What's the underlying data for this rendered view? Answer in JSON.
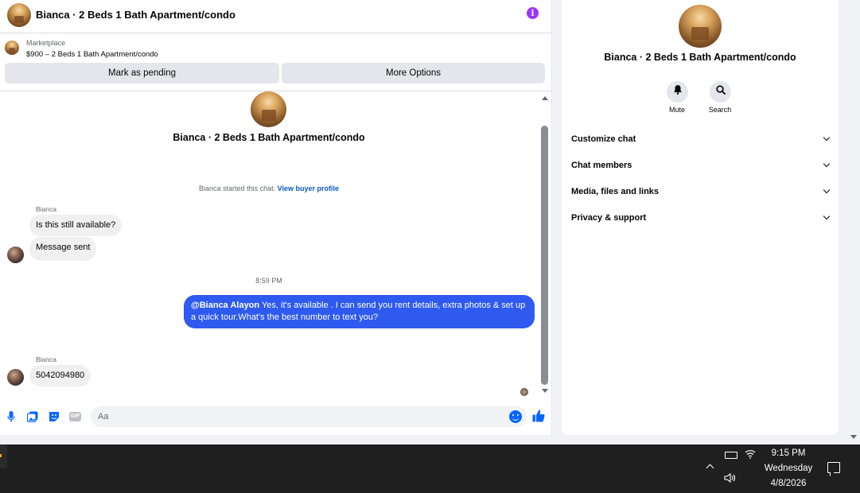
{
  "chat": {
    "header_title": "Bianca · 2 Beds 1 Bath Apartment/condo",
    "marketplace_label": "Marketplace",
    "listing_title": "$900 – 2 Beds 1 Bath Apartment/condo",
    "mark_pending_label": "Mark as pending",
    "more_options_label": "More Options",
    "center_title": "Bianca · 2 Beds 1 Bath Apartment/condo",
    "started_text": "Bianca started this chat.",
    "view_profile_link": "View buyer profile",
    "messages": [
      {
        "sender": "Bianca",
        "text": "Is this still available?"
      },
      {
        "text": "Message sent"
      },
      {
        "timestamp": "8:59 PM"
      },
      {
        "mention": "@Bianca Alayon",
        "text": " Yes, it's available .  I can send you rent details, extra photos & set up a quick tour.What's the best number to text you?"
      },
      {
        "sender": "Bianca",
        "text": "5042094980"
      }
    ],
    "composer_placeholder": "Aa",
    "gif_label": "GIF"
  },
  "info_panel": {
    "title": "Bianca · 2 Beds 1 Bath Apartment/condo",
    "mute_label": "Mute",
    "search_label": "Search",
    "sections": [
      "Customize chat",
      "Chat members",
      "Media, files and links",
      "Privacy & support"
    ]
  },
  "taskbar": {
    "time": "9:15 PM",
    "day": "Wednesday",
    "date": "4/8/2026"
  },
  "colors": {
    "accent_blue": "#0866ff",
    "outgoing_bubble": "#2e5aef",
    "info_icon": "#a033ff"
  }
}
